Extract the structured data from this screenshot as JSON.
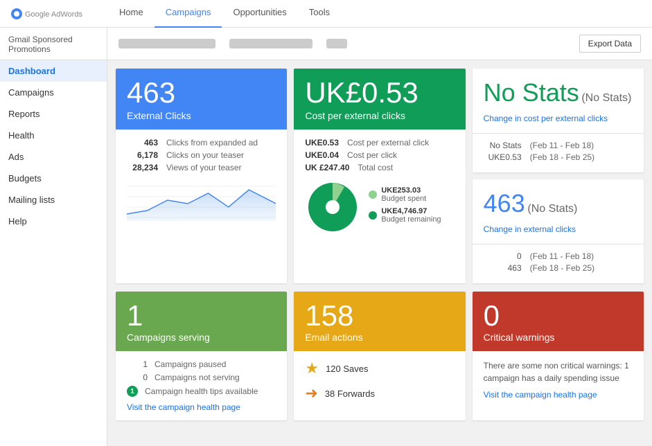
{
  "nav": {
    "links": [
      {
        "label": "Home",
        "active": false
      },
      {
        "label": "Campaigns",
        "active": true
      },
      {
        "label": "Opportunities",
        "active": false
      },
      {
        "label": "Tools",
        "active": false
      }
    ]
  },
  "sidebar": {
    "header": "Gmail Sponsored Promotions",
    "items": [
      {
        "label": "Dashboard",
        "active": true
      },
      {
        "label": "Campaigns",
        "active": false
      },
      {
        "label": "Reports",
        "active": false
      },
      {
        "label": "Health",
        "active": false
      },
      {
        "label": "Ads",
        "active": false
      },
      {
        "label": "Budgets",
        "active": false
      },
      {
        "label": "Mailing lists",
        "active": false
      },
      {
        "label": "Help",
        "active": false
      }
    ]
  },
  "toolbar": {
    "export_label": "Export Data"
  },
  "card_clicks": {
    "big_num": "463",
    "subtitle": "External Clicks",
    "stats": [
      {
        "num": "463",
        "label": "Clicks from expanded ad"
      },
      {
        "num": "6,178",
        "label": "Clicks on your teaser"
      },
      {
        "num": "28,234",
        "label": "Views of your teaser"
      }
    ]
  },
  "card_cost": {
    "big_num": "UK£0.53",
    "subtitle": "Cost per external clicks",
    "stats": [
      {
        "num": "UKE0.53",
        "label": "Cost per external click"
      },
      {
        "num": "UKE0.04",
        "label": "Cost per click"
      },
      {
        "num": "UK £247.40",
        "label": "Total cost"
      }
    ],
    "pie": {
      "spent_label": "UKE253.03",
      "spent_desc": "Budget spent",
      "remaining_label": "UKE4,746.97",
      "remaining_desc": "Budget remaining"
    }
  },
  "card_no_stats": {
    "big_num": "No Stats",
    "paren": "(No Stats)",
    "link": "Change in cost per external clicks",
    "rows": [
      {
        "num": "No Stats",
        "label": "(Feb 11 - Feb 18)"
      },
      {
        "num": "UKE0.53",
        "label": "(Feb 18 - Feb 25)"
      }
    ]
  },
  "card_463": {
    "big_num": "463",
    "paren": "(No Stats)",
    "link": "Change in external clicks",
    "rows": [
      {
        "num": "0",
        "label": "(Feb 11 - Feb 18)"
      },
      {
        "num": "463",
        "label": "(Feb 18 - Feb 25)"
      }
    ]
  },
  "card_campaigns": {
    "big_num": "1",
    "subtitle": "Campaigns serving",
    "stats": [
      {
        "num": "1",
        "label": "Campaigns paused"
      },
      {
        "num": "0",
        "label": "Campaigns not serving"
      },
      {
        "num": "1",
        "label": "Campaign health tips available",
        "badge": true
      }
    ],
    "link": "Visit the campaign health page"
  },
  "card_email": {
    "big_num": "158",
    "subtitle": "Email actions",
    "saves": "120 Saves",
    "forwards": "38 Forwards"
  },
  "card_warnings": {
    "big_num": "0",
    "subtitle": "Critical warnings",
    "warning_text": "There are some non critical warnings: 1 campaign has a daily spending issue",
    "link": "Visit the campaign health page"
  }
}
